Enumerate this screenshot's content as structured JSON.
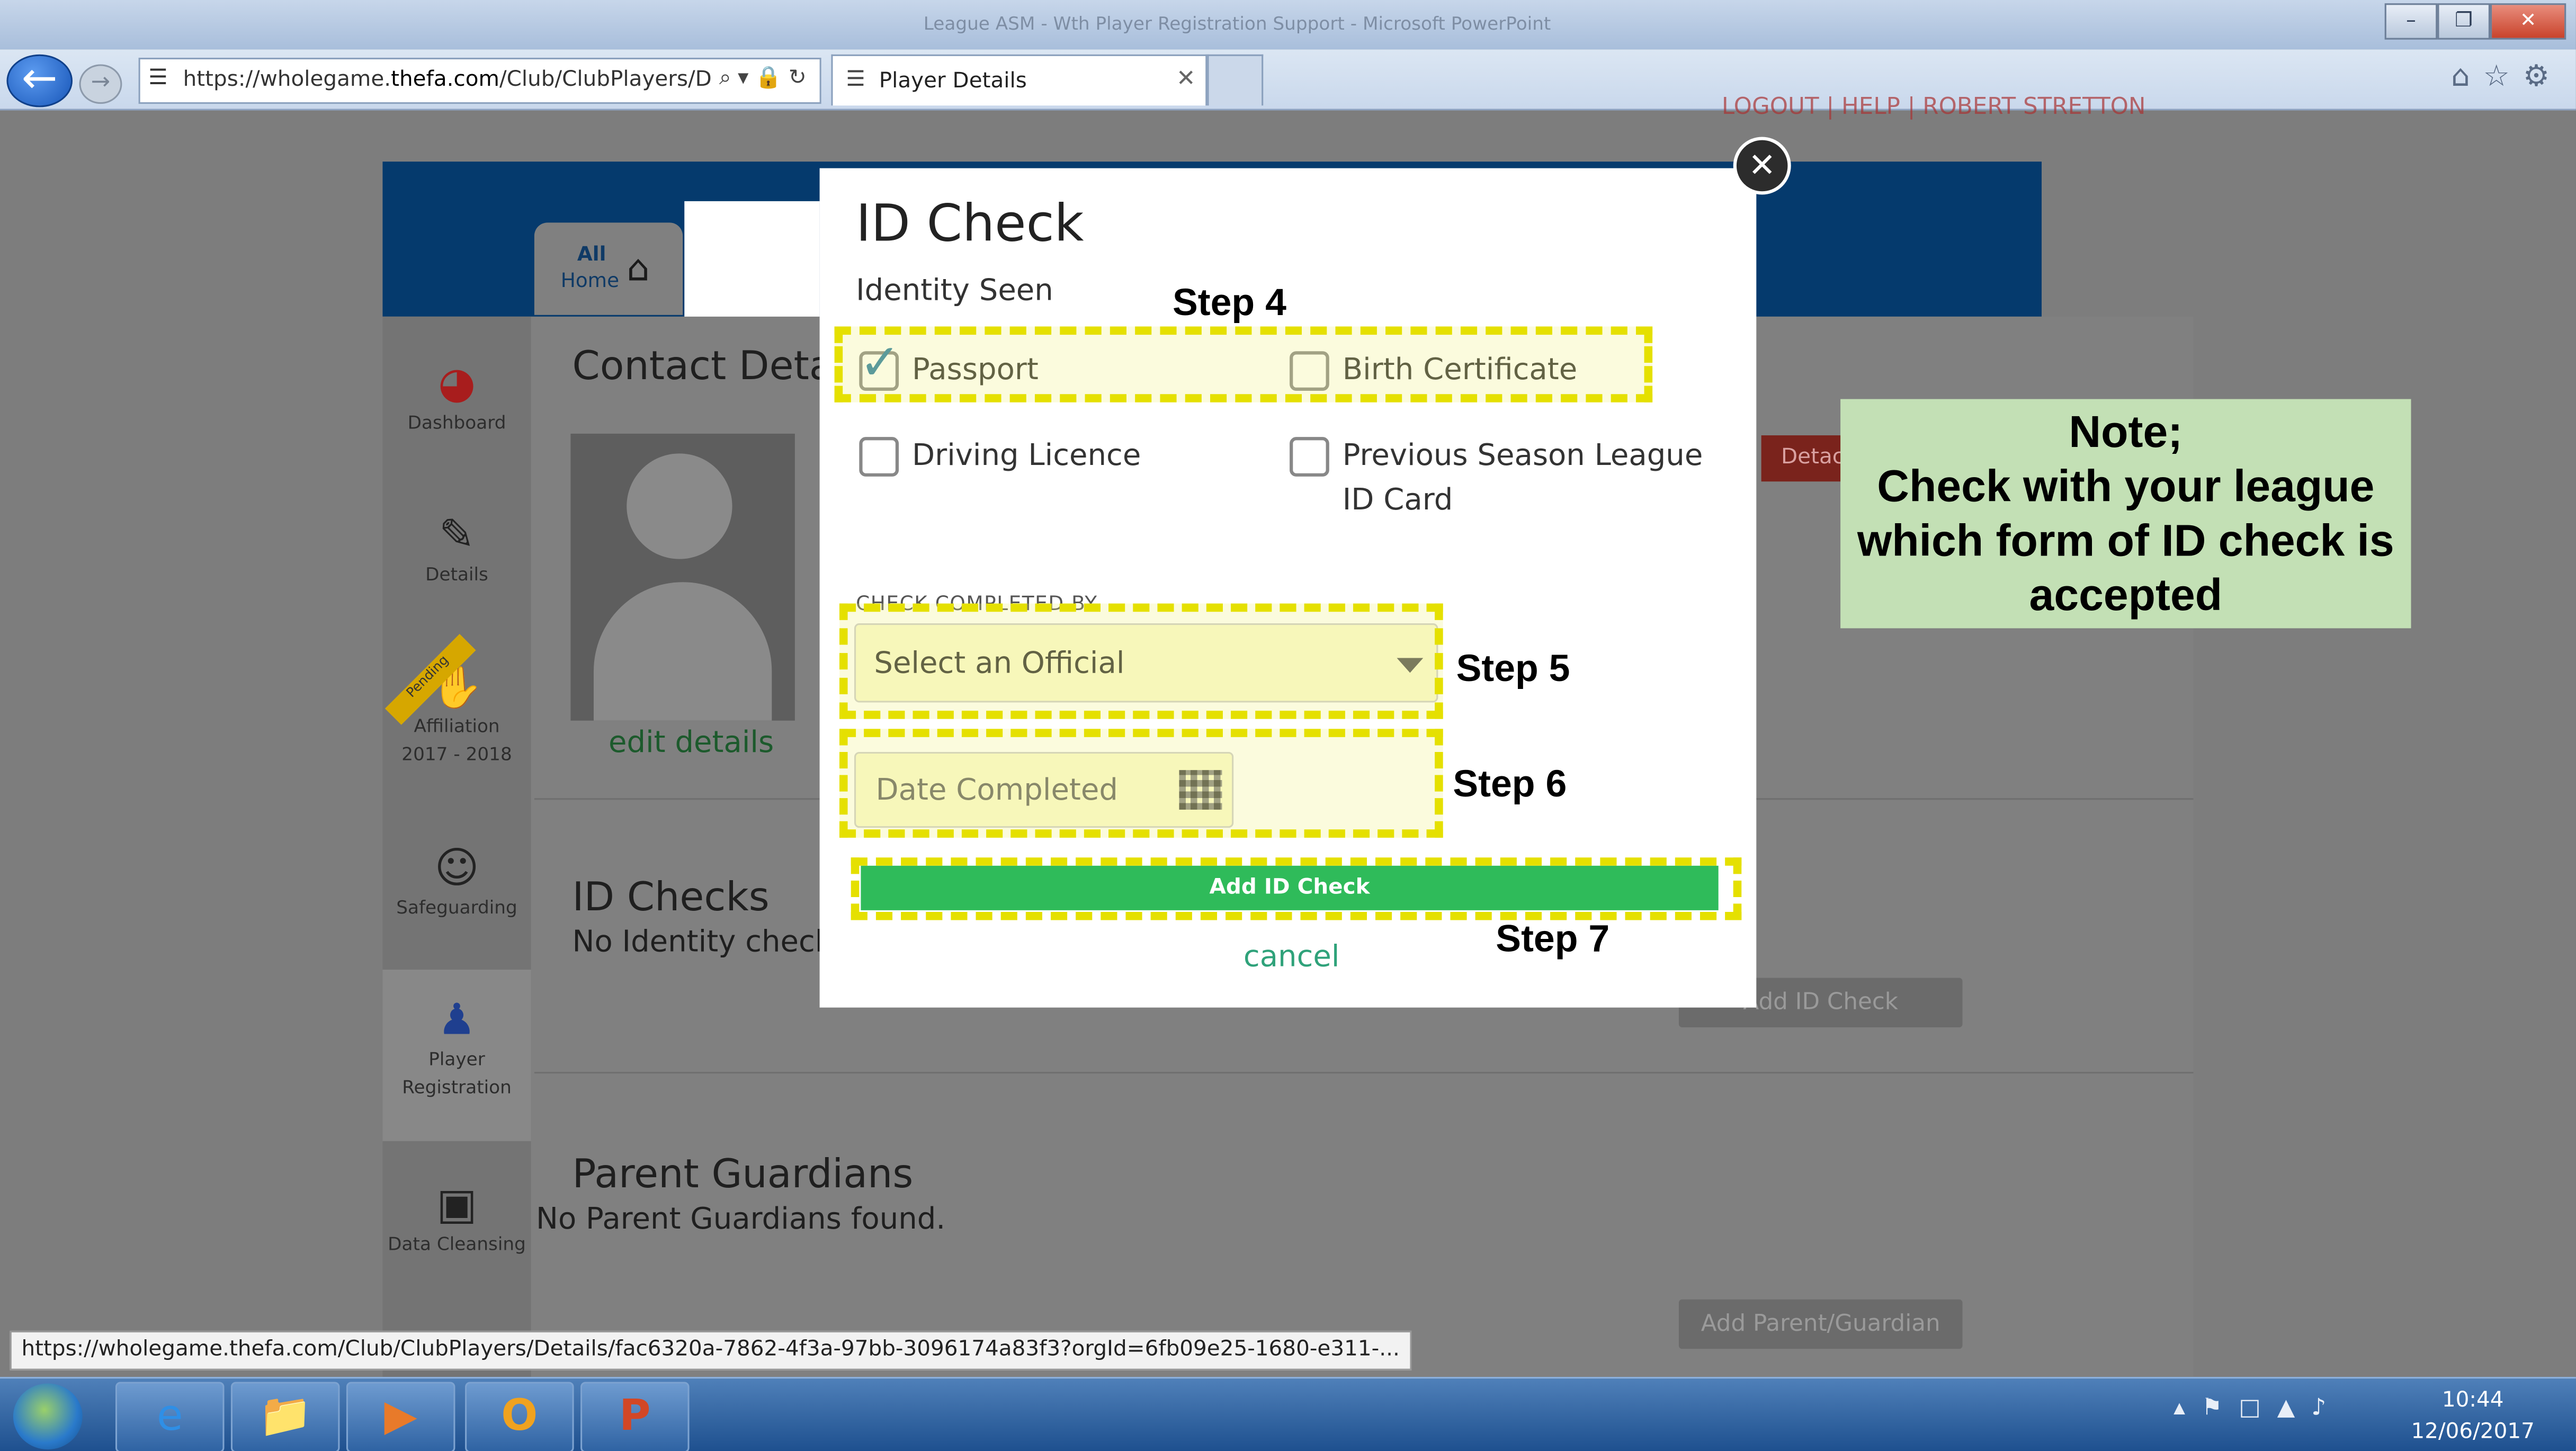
{
  "window": {
    "title": "League ASM - Wth Player Registration Support - Microsoft PowerPoint"
  },
  "browser": {
    "address_url_pre": "https://wholegame.",
    "address_url_domain": "thefa.com",
    "address_url_post": "/Club/ClubPlayers/D",
    "tab_title": "Player Details",
    "status_url": "https://wholegame.thefa.com/Club/ClubPlayers/Details/fac6320a-7862-4f3a-97bb-3096174a83f3?orgId=6fb09e25-1680-e311-..."
  },
  "site": {
    "top_links": "LOGOUT | HELP | ROBERT STRETTON",
    "home_tab": {
      "line1": "All",
      "line2": "Home"
    }
  },
  "sidebar": {
    "items": [
      {
        "label": "Dashboard"
      },
      {
        "label": "Details"
      },
      {
        "label": "Affiliation",
        "sublabel": "2017 - 2018",
        "badge": "Pending"
      },
      {
        "label": "Safeguarding"
      },
      {
        "label": "Player",
        "sublabel": "Registration"
      },
      {
        "label": "Data Cleansing"
      }
    ]
  },
  "main": {
    "contact_heading": "Contact Deta",
    "edit_details": "edit details",
    "details_tag": "Detac",
    "id_checks_heading": "ID Checks",
    "id_checks_empty": "No Identity checks",
    "add_id_check_bg": "Add ID Check",
    "parent_heading": "Parent Guardians",
    "parent_empty": "No Parent Guardians found.",
    "add_parent": "Add Parent/Guardian"
  },
  "modal": {
    "title": "ID Check",
    "subtitle": "Identity Seen",
    "checkboxes": [
      {
        "label": "Passport",
        "checked": true
      },
      {
        "label": "Birth Certificate",
        "checked": false
      },
      {
        "label": "Driving Licence",
        "checked": false
      },
      {
        "label": "Previous Season League ID Card",
        "checked": false
      }
    ],
    "check_completed_by_label": "CHECK COMPLETED BY",
    "official_select": "Select an Official",
    "date_placeholder": "Date Completed",
    "submit": "Add ID Check",
    "cancel": "cancel"
  },
  "annotations": {
    "step4": "Step 4",
    "step5": "Step 5",
    "step6": "Step 6",
    "step7": "Step 7",
    "note_title": "Note;",
    "note_body": "Check with your league which form of ID check is accepted"
  },
  "taskbar": {
    "time": "10:44",
    "date": "12/06/2017"
  },
  "colors": {
    "banner": "#053a6d",
    "add_button": "#2fbb5a",
    "highlight": "#e5e000",
    "note_bg": "#c3e0b5"
  }
}
